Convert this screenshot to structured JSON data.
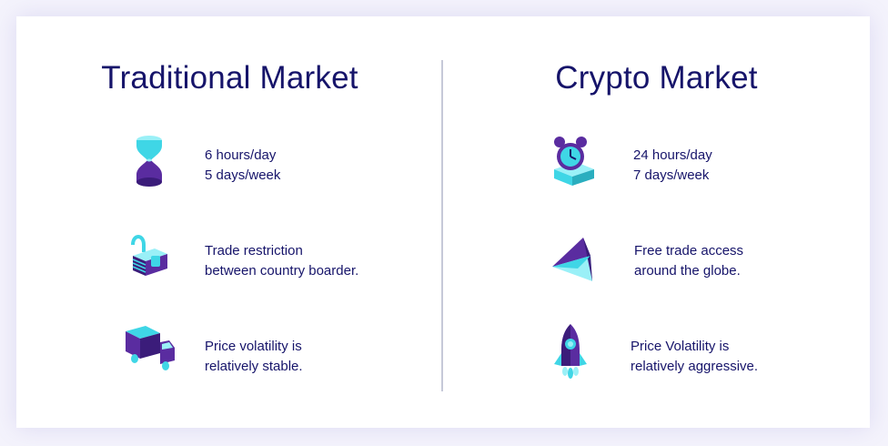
{
  "columns": [
    {
      "title": "Traditional Market",
      "features": [
        {
          "icon": "hourglass-icon",
          "lines": [
            "6 hours/day",
            "5 days/week"
          ]
        },
        {
          "icon": "locked-cash-icon",
          "lines": [
            "Trade restriction",
            "between country boarder."
          ]
        },
        {
          "icon": "delivery-truck-icon",
          "lines": [
            "Price volatility is",
            "relatively stable."
          ]
        }
      ]
    },
    {
      "title": "Crypto Market",
      "features": [
        {
          "icon": "alarm-clock-icon",
          "lines": [
            "24 hours/day",
            "7 days/week"
          ]
        },
        {
          "icon": "paper-plane-icon",
          "lines": [
            "Free trade access",
            "around the globe."
          ]
        },
        {
          "icon": "rocket-icon",
          "lines": [
            "Price Volatility is",
            "relatively aggressive."
          ]
        }
      ]
    }
  ],
  "colors": {
    "title": "#16146a",
    "text": "#16146a",
    "purple": "#5a2ca0",
    "purple_dark": "#3b1c7a",
    "cyan": "#3fd6e6",
    "cyan_light": "#9af0f7",
    "divider": "#c6c9d8"
  }
}
